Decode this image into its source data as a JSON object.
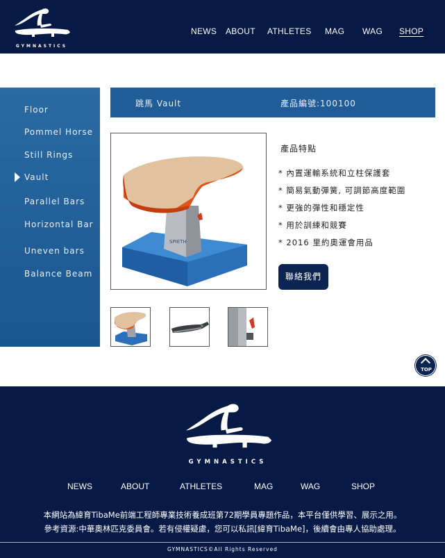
{
  "brand": {
    "logo_text": "GYMNASTICS"
  },
  "top_nav": [
    {
      "label": "NEWS"
    },
    {
      "label": "ABOUT"
    },
    {
      "label": "ATHLETES"
    },
    {
      "label": "MAG"
    },
    {
      "label": "WAG"
    },
    {
      "label": "SHOP",
      "active": true
    }
  ],
  "sidebar": {
    "items": [
      {
        "label": "Floor"
      },
      {
        "label": "Pommel Horse"
      },
      {
        "label": "Still Rings"
      },
      {
        "label": "Vault",
        "selected": true
      },
      {
        "label": "Parallel Bars"
      },
      {
        "label": "Horizontal Bar"
      },
      {
        "label": "Uneven bars"
      },
      {
        "label": "Balance Beam"
      }
    ]
  },
  "product": {
    "name": "跳馬 Vault",
    "code": "產品編號:100100",
    "features_title": "產品特點",
    "features": [
      "* 內置運輸系統和立柱保護套",
      "* 簡易氣動彈簧, 可調節高度範圍",
      "* 更強的彈性和穩定性",
      "* 用於訓練和競賽",
      "* 2016 里約奧運會用品"
    ],
    "contact_label": "聯絡我們",
    "image_brand": "SPIETH"
  },
  "top_button": {
    "label": "TOP"
  },
  "footer": {
    "logo_text": "GYMNASTICS",
    "nav": [
      {
        "label": "NEWS"
      },
      {
        "label": "ABOUT"
      },
      {
        "label": "ATHLETES"
      },
      {
        "label": "MAG"
      },
      {
        "label": "WAG"
      },
      {
        "label": "SHOP"
      }
    ],
    "credit_line1": "本網站為緯育TibaMe前端工程師專業技術養成班第72期學員專題作品，本平台僅供學習、展示之用。",
    "credit_line2": "參考資源:中華奧林匹克委員會。若有侵權疑慮，您可以私訊[緯育TibaMe]，後續會由專人協助處理。",
    "copyright": "GYMNASTICS©All Rights Reserved"
  },
  "colors": {
    "navy": "#061a45",
    "sidebar_blue": "#2b6aa3",
    "titlebar_blue": "#205c98",
    "button_navy": "#0b2452"
  }
}
